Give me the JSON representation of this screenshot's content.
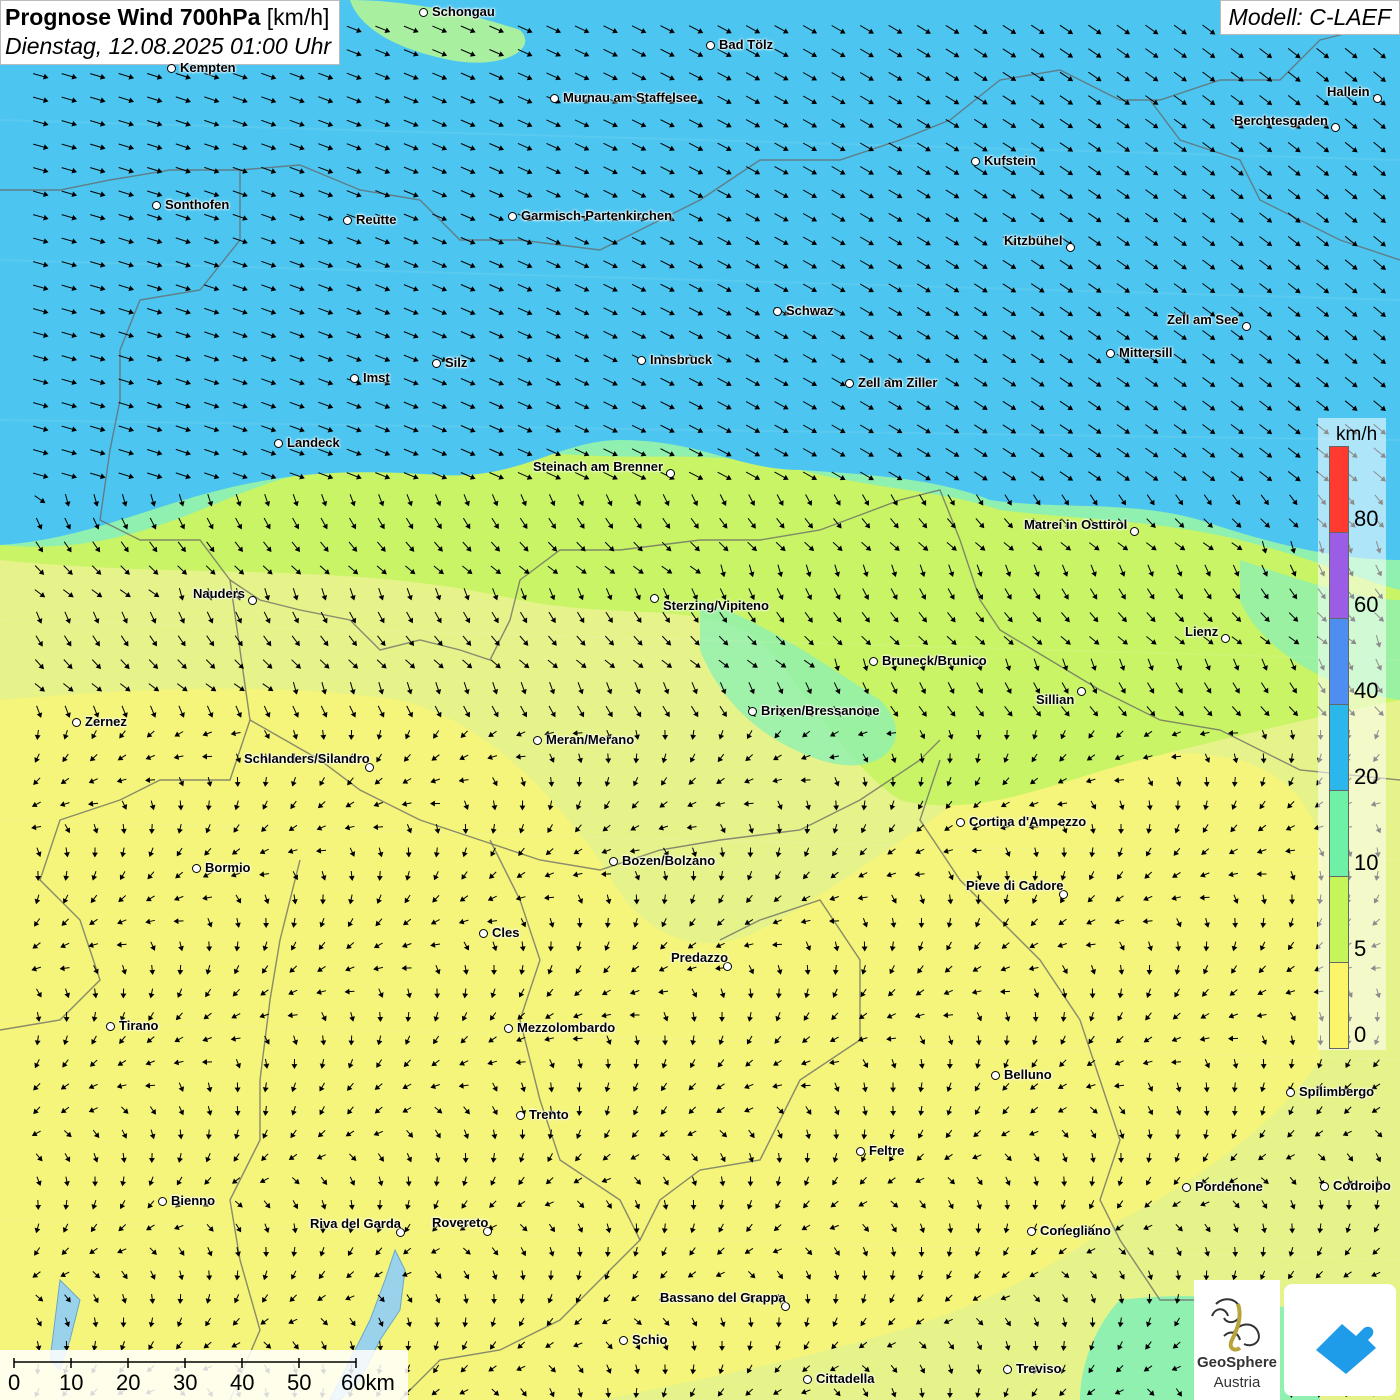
{
  "header": {
    "title_bold": "Prognose Wind 700hPa",
    "title_unit": "[km/h]",
    "datetime": "Dienstag, 12.08.2025 01:00 Uhr",
    "model": "Modell: C-LAEF"
  },
  "legend": {
    "unit": "km/h",
    "bins": [
      {
        "color": "#ff3b30"
      },
      {
        "color": "#9b5de5"
      },
      {
        "color": "#4d8ef0"
      },
      {
        "color": "#2bb7ec"
      },
      {
        "color": "#6ef0a6"
      },
      {
        "color": "#c6f55a"
      },
      {
        "color": "#fbf56a"
      }
    ],
    "labels": [
      "80",
      "60",
      "40",
      "20",
      "10",
      "5",
      "0"
    ]
  },
  "scalebar": {
    "labels": [
      "0",
      "10",
      "20",
      "30",
      "40",
      "50",
      "60km"
    ]
  },
  "branding": {
    "name": "GeoSphere",
    "sub": "Austria"
  },
  "cities": [
    {
      "name": "Schongau"
    },
    {
      "name": "Bad Tölz"
    },
    {
      "name": "Kempten"
    },
    {
      "name": "Murnau am Staffelsee"
    },
    {
      "name": "Hallein"
    },
    {
      "name": "Berchtesgaden"
    },
    {
      "name": "Kufstein"
    },
    {
      "name": "Sonthofen"
    },
    {
      "name": "Reutte"
    },
    {
      "name": "Garmisch-Partenkirchen"
    },
    {
      "name": "Kitzbühel"
    },
    {
      "name": "Schwaz"
    },
    {
      "name": "Zell am See"
    },
    {
      "name": "Innsbruck"
    },
    {
      "name": "Mittersill"
    },
    {
      "name": "Silz"
    },
    {
      "name": "Imst"
    },
    {
      "name": "Zell am Ziller"
    },
    {
      "name": "Landeck"
    },
    {
      "name": "Steinach am Brenner"
    },
    {
      "name": "Matrei in Osttirol"
    },
    {
      "name": "Nauders"
    },
    {
      "name": "Sterzing/Vipiteno"
    },
    {
      "name": "Lienz"
    },
    {
      "name": "Bruneck/Brunico"
    },
    {
      "name": "Sillian"
    },
    {
      "name": "Zernez"
    },
    {
      "name": "Brixen/Bressanone"
    },
    {
      "name": "Meran/Merano"
    },
    {
      "name": "Schlanders/Silandro"
    },
    {
      "name": "Cortina d'Ampezzo"
    },
    {
      "name": "Bozen/Bolzano"
    },
    {
      "name": "Bormio"
    },
    {
      "name": "Pieve di Cadore"
    },
    {
      "name": "Cles"
    },
    {
      "name": "Predazzo"
    },
    {
      "name": "Tirano"
    },
    {
      "name": "Mezzolombardo"
    },
    {
      "name": "Belluno"
    },
    {
      "name": "Spilimbergo"
    },
    {
      "name": "Trento"
    },
    {
      "name": "Feltre"
    },
    {
      "name": "Pordenone"
    },
    {
      "name": "Codroipo"
    },
    {
      "name": "Bienno"
    },
    {
      "name": "Riva del Garda"
    },
    {
      "name": "Rovereto"
    },
    {
      "name": "Conegliano"
    },
    {
      "name": "Bassano del Grappa"
    },
    {
      "name": "Schio"
    },
    {
      "name": "Treviso"
    },
    {
      "name": "Cittadella"
    }
  ]
}
